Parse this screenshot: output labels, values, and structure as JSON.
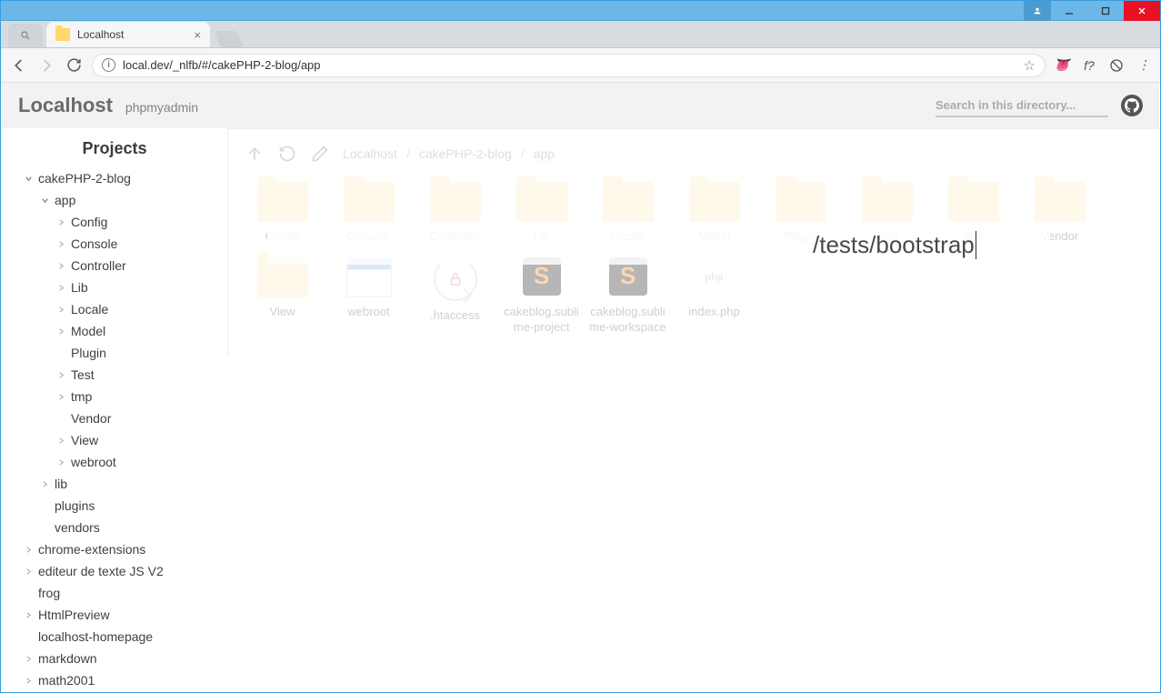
{
  "window": {
    "tab_title": "Localhost",
    "address": "local.dev/_nlfb/#/cakePHP-2-blog/app"
  },
  "header": {
    "title": "Localhost",
    "sublink": "phpmyadmin",
    "search_placeholder": "Search in this directory..."
  },
  "sidebar": {
    "title": "Projects",
    "tree": [
      {
        "label": "cakePHP-2-blog",
        "indent": 0,
        "chev": "open"
      },
      {
        "label": "app",
        "indent": 1,
        "chev": "open"
      },
      {
        "label": "Config",
        "indent": 2,
        "chev": "closed"
      },
      {
        "label": "Console",
        "indent": 2,
        "chev": "closed"
      },
      {
        "label": "Controller",
        "indent": 2,
        "chev": "closed"
      },
      {
        "label": "Lib",
        "indent": 2,
        "chev": "closed"
      },
      {
        "label": "Locale",
        "indent": 2,
        "chev": "closed"
      },
      {
        "label": "Model",
        "indent": 2,
        "chev": "closed"
      },
      {
        "label": "Plugin",
        "indent": 2,
        "chev": "none"
      },
      {
        "label": "Test",
        "indent": 2,
        "chev": "closed"
      },
      {
        "label": "tmp",
        "indent": 2,
        "chev": "closed"
      },
      {
        "label": "Vendor",
        "indent": 2,
        "chev": "none"
      },
      {
        "label": "View",
        "indent": 2,
        "chev": "closed"
      },
      {
        "label": "webroot",
        "indent": 2,
        "chev": "closed"
      },
      {
        "label": "lib",
        "indent": 1,
        "chev": "closed"
      },
      {
        "label": "plugins",
        "indent": 1,
        "chev": "none"
      },
      {
        "label": "vendors",
        "indent": 1,
        "chev": "none"
      },
      {
        "label": "chrome-extensions",
        "indent": 0,
        "chev": "closed"
      },
      {
        "label": "editeur de texte JS V2",
        "indent": 0,
        "chev": "closed"
      },
      {
        "label": "frog",
        "indent": 0,
        "chev": "none"
      },
      {
        "label": "HtmlPreview",
        "indent": 0,
        "chev": "closed"
      },
      {
        "label": "localhost-homepage",
        "indent": 0,
        "chev": "none"
      },
      {
        "label": "markdown",
        "indent": 0,
        "chev": "closed"
      },
      {
        "label": "math2001",
        "indent": 0,
        "chev": "closed"
      }
    ]
  },
  "breadcrumb": [
    "Localhost",
    "cakePHP-2-blog",
    "app"
  ],
  "files_row1": [
    {
      "label": "Config",
      "type": "folder"
    },
    {
      "label": "Console",
      "type": "folder"
    },
    {
      "label": "Controller",
      "type": "folder"
    },
    {
      "label": "Lib",
      "type": "folder"
    },
    {
      "label": "Locale",
      "type": "folder"
    },
    {
      "label": "Model",
      "type": "folder"
    },
    {
      "label": "Plugin",
      "type": "folder"
    },
    {
      "label": "Test",
      "type": "folder"
    },
    {
      "label": "tmp",
      "type": "folder"
    },
    {
      "label": "Vendor",
      "type": "folder"
    }
  ],
  "files_row2": [
    {
      "label": "View",
      "type": "folder"
    },
    {
      "label": "webroot",
      "type": "web"
    },
    {
      "label": ".htaccess",
      "type": "lock"
    },
    {
      "label": "cakeblog.sublime-project",
      "type": "sublime"
    },
    {
      "label": "cakeblog.sublime-workspace",
      "type": "sublime"
    },
    {
      "label": "index.php",
      "type": "php"
    }
  ],
  "search_overlay_text": "/tests/bootstrap"
}
